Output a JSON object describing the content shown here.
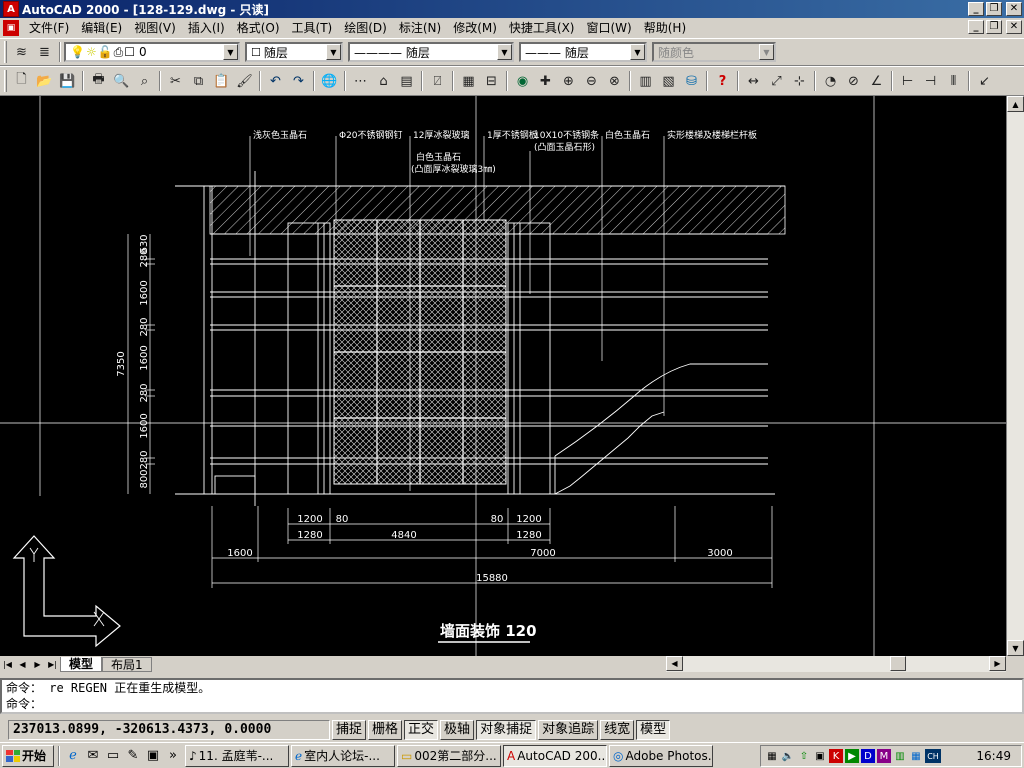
{
  "window": {
    "title": "AutoCAD 2000 - [128-129.dwg - 只读]",
    "app_icon": "autocad-icon"
  },
  "menu": [
    "文件(F)",
    "编辑(E)",
    "视图(V)",
    "插入(I)",
    "格式(O)",
    "工具(T)",
    "绘图(D)",
    "标注(N)",
    "修改(M)",
    "快捷工具(X)",
    "窗口(W)",
    "帮助(H)"
  ],
  "properties_toolbar": {
    "layer_value": "0",
    "color_value": "随层",
    "linetype_value": "———— 随层",
    "lineweight_value": "——— 随层",
    "plotstyle_value": "随颜色"
  },
  "drawing": {
    "title": "墙面装饰 120",
    "callouts": [
      "浅灰色玉晶石",
      "Φ20不锈钢钢钉",
      "12厚冰裂玻璃",
      "白色玉晶石",
      "(凸面厚冰裂玻璃3㎜)",
      "1厚不锈钢板",
      "10X10不锈钢条",
      "(凸面玉晶石形)",
      "白色玉晶石",
      "实形楼梯及楼梯栏杆板"
    ],
    "vertical_dims": [
      "630",
      "280",
      "1600",
      "280",
      "1600",
      "280",
      "1600",
      "280",
      "800"
    ],
    "total_height": "7350",
    "bottom_dims_row1": [
      "1200",
      "80",
      "80",
      "1200"
    ],
    "bottom_dims_row2": [
      "1280",
      "4840",
      "1280"
    ],
    "bottom_dims_row3": [
      "1600",
      "7000",
      "3000"
    ],
    "total_width": "15880"
  },
  "layout_tabs": [
    "模型",
    "布局1"
  ],
  "command": {
    "line1": "命令： re REGEN 正在重生成模型。",
    "line2": "命令："
  },
  "status": {
    "coords": "237013.0899, -320613.4373, 0.0000",
    "toggles": [
      "捕捉",
      "栅格",
      "正交",
      "极轴",
      "对象捕捉",
      "对象追踪",
      "线宽",
      "模型"
    ]
  },
  "taskbar": {
    "start": "开始",
    "tasks": [
      "11. 孟庭苇-...",
      "室内人论坛-...",
      "002第二部分...",
      "AutoCAD 200...",
      "Adobe Photos..."
    ],
    "clock": "16:49",
    "lang": "CH"
  }
}
